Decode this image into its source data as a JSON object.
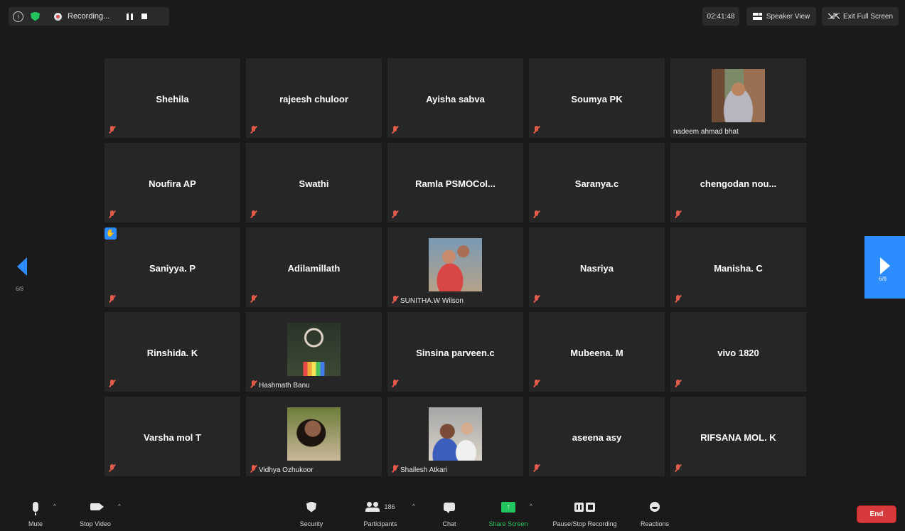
{
  "top_bar": {
    "recording_label": "Recording...",
    "timer": "02:41:48",
    "speaker_view_label": "Speaker View",
    "exit_fullscreen_label": "Exit Full Screen"
  },
  "grid": {
    "tiles": [
      {
        "name": "Shehila",
        "has_video": false
      },
      {
        "name": "rajeesh chuloor",
        "has_video": false
      },
      {
        "name": "Ayisha  sabva",
        "has_video": false
      },
      {
        "name": "Soumya PK",
        "has_video": false
      },
      {
        "name": "nadeem ahmad bhat",
        "has_video": true
      },
      {
        "name": "Noufira AP",
        "has_video": false
      },
      {
        "name": "Swathi",
        "has_video": false
      },
      {
        "name": "Ramla  PSMOCol...",
        "has_video": false
      },
      {
        "name": "Saranya.c",
        "has_video": false
      },
      {
        "name": "chengodan  nou...",
        "has_video": false
      },
      {
        "name": "Saniyya. P",
        "has_video": false,
        "hand_raised": true
      },
      {
        "name": "Adilamillath",
        "has_video": false
      },
      {
        "name": "SUNITHA.W Wilson",
        "has_video": true
      },
      {
        "name": "Nasriya",
        "has_video": false
      },
      {
        "name": "Manisha. C",
        "has_video": false
      },
      {
        "name": "Rinshida. K",
        "has_video": false
      },
      {
        "name": "Hashmath Banu",
        "has_video": true
      },
      {
        "name": "Sinsina parveen.c",
        "has_video": false
      },
      {
        "name": "Mubeena. M",
        "has_video": false
      },
      {
        "name": "vivo 1820",
        "has_video": false
      },
      {
        "name": "Varsha mol T",
        "has_video": false
      },
      {
        "name": "Vidhya Ozhukoor",
        "has_video": true
      },
      {
        "name": "Shailesh Atkari",
        "has_video": true
      },
      {
        "name": "aseena asy",
        "has_video": false
      },
      {
        "name": "RIFSANA MOL. K",
        "has_video": false
      }
    ]
  },
  "pagination": {
    "left_label": "6/8",
    "right_label": "6/8"
  },
  "toolbar": {
    "mute_label": "Mute",
    "stop_video_label": "Stop Video",
    "security_label": "Security",
    "participants_label": "Participants",
    "participants_count": "186",
    "chat_label": "Chat",
    "share_screen_label": "Share Screen",
    "pause_stop_label": "Pause/Stop Recording",
    "reactions_label": "Reactions",
    "end_label": "End"
  },
  "colors": {
    "accent": "#2d8cff",
    "share": "#22c55e",
    "end": "#d63a3a",
    "muted": "#e25b4b"
  }
}
